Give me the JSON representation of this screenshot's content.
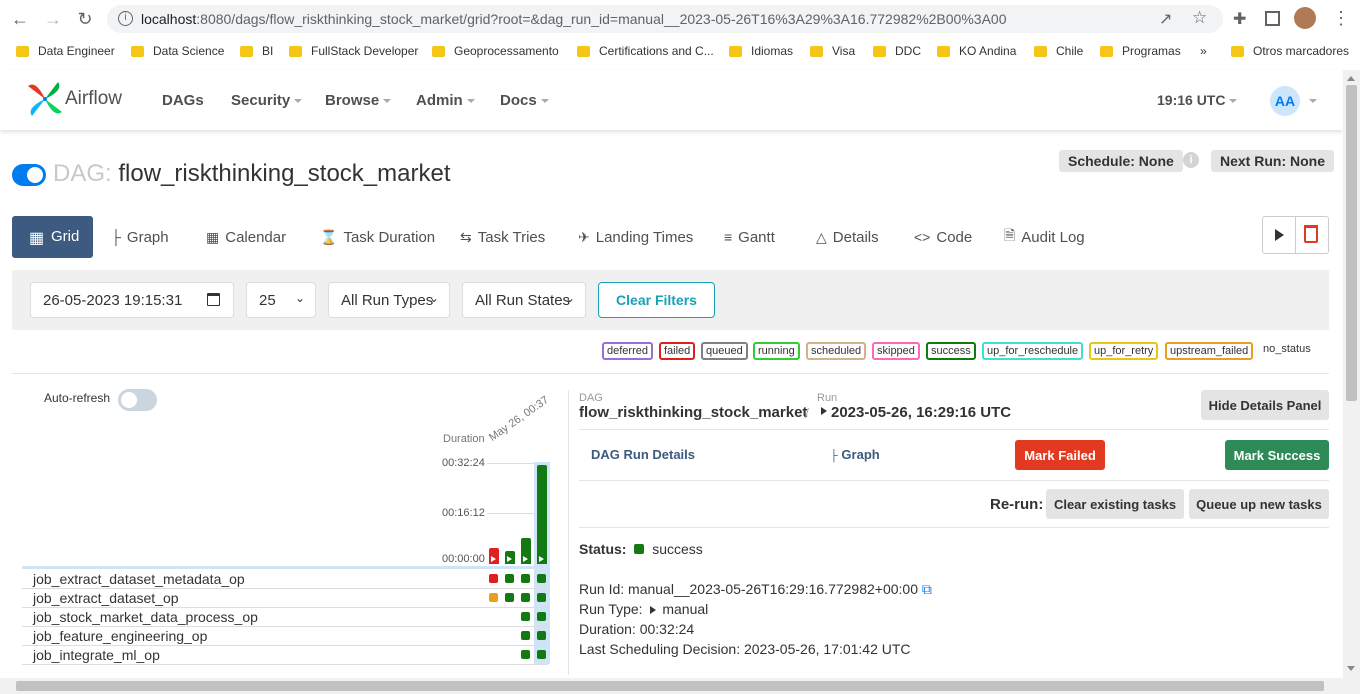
{
  "browser": {
    "url_host": "localhost",
    "url_rest": ":8080/dags/flow_riskthinking_stock_market/grid?root=&dag_run_id=manual__2023-05-26T16%3A29%3A16.772982%2B00%3A00",
    "bookmarks": [
      "Data Engineer",
      "Data Science",
      "BI",
      "FullStack Developer",
      "Geoprocessamento",
      "Certifications and C...",
      "Idiomas",
      "Visa",
      "DDC",
      "KO Andina",
      "Chile",
      "Programas"
    ],
    "more_bookmarks": "»",
    "other_bookmarks": "Otros marcadores"
  },
  "nav": {
    "brand": "Airflow",
    "items": [
      "DAGs",
      "Security",
      "Browse",
      "Admin",
      "Docs"
    ],
    "time": "19:16 UTC",
    "avatar": "AA"
  },
  "dag": {
    "prefix": "DAG:",
    "name": "flow_riskthinking_stock_market",
    "schedule": "Schedule: None",
    "next_run": "Next Run: None",
    "paused": false
  },
  "tabs": [
    "Grid",
    "Graph",
    "Calendar",
    "Task Duration",
    "Task Tries",
    "Landing Times",
    "Gantt",
    "Details",
    "Code",
    "Audit Log"
  ],
  "filters": {
    "date": "26-05-2023  19:15:31",
    "num_runs": "25",
    "run_types": "All Run Types",
    "run_states": "All Run States",
    "clear": "Clear Filters"
  },
  "legend": [
    {
      "label": "deferred",
      "color": "#9370db"
    },
    {
      "label": "failed",
      "color": "#e02020"
    },
    {
      "label": "queued",
      "color": "#808080"
    },
    {
      "label": "running",
      "color": "#32cd32"
    },
    {
      "label": "scheduled",
      "color": "#d2b48c"
    },
    {
      "label": "skipped",
      "color": "#ff69b4"
    },
    {
      "label": "success",
      "color": "#137a13"
    },
    {
      "label": "up_for_reschedule",
      "color": "#40e0d0"
    },
    {
      "label": "up_for_retry",
      "color": "#e6c619"
    },
    {
      "label": "upstream_failed",
      "color": "#e8a020"
    },
    {
      "label": "no_status",
      "color": ""
    }
  ],
  "grid": {
    "auto_refresh": "Auto-refresh",
    "duration_label": "Duration",
    "date_label": "May 26, 00:37",
    "ticks": [
      "00:32:24",
      "00:16:12",
      "00:00:00"
    ],
    "tasks": [
      "job_extract_dataset_metadata_op",
      "job_extract_dataset_op",
      "job_stock_market_data_process_op",
      "job_feature_engineering_op",
      "job_integrate_ml_op"
    ]
  },
  "details": {
    "dag_label": "DAG",
    "run_label": "Run",
    "dag_name": "flow_riskthinking_stock_market",
    "separator": "/",
    "run_name": "2023-05-26, 16:29:16 UTC",
    "hide_panel": "Hide Details Panel",
    "run_details": "DAG Run Details",
    "graph": "Graph",
    "mark_failed": "Mark Failed",
    "mark_success": "Mark Success",
    "rerun": "Re-run:",
    "clear_tasks": "Clear existing tasks",
    "queue_tasks": "Queue up new tasks",
    "status_label": "Status:",
    "status": "success",
    "run_id": "Run Id: manual__2023-05-26T16:29:16.772982+00:00",
    "run_type_label": "Run Type:",
    "run_type": "manual",
    "duration": "Duration: 00:32:24",
    "last_sched": "Last Scheduling Decision: 2023-05-26, 17:01:42 UTC"
  }
}
